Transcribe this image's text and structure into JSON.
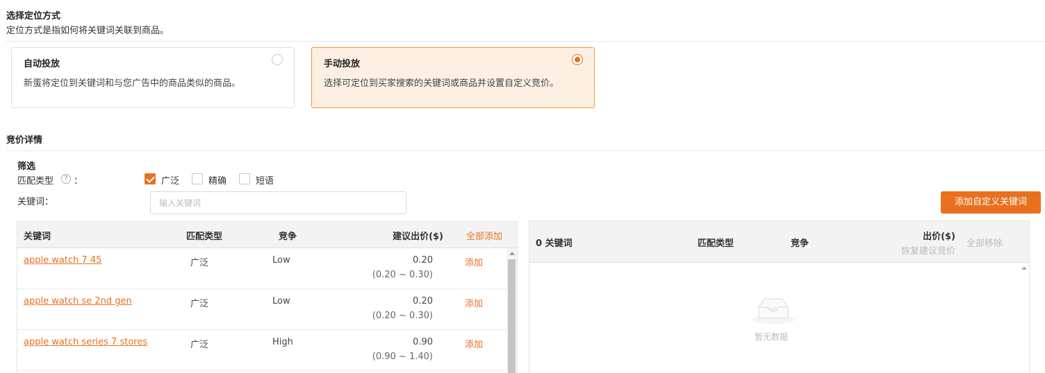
{
  "targeting": {
    "title": "选择定位方式",
    "description": "定位方式是指如何将关键词关联到商品。",
    "options": [
      {
        "title": "自动投放",
        "description": "新蛋将定位到关键词和与您广告中的商品类似的商品。",
        "selected": false
      },
      {
        "title": "手动投放",
        "description": "选择可定位到买家搜索的关键词或商品并设置自定义竞价。",
        "selected": true
      }
    ]
  },
  "bidding": {
    "title": "竞价详情",
    "filter_title": "筛选",
    "match_type_label": "匹配类型",
    "help_glyph": "?",
    "colon": "：",
    "match_options": [
      {
        "label": "广泛",
        "checked": true
      },
      {
        "label": "精确",
        "checked": false
      },
      {
        "label": "短语",
        "checked": false
      }
    ],
    "keyword_label": "关键词：",
    "keyword_placeholder": "输入关键词",
    "add_custom_button": "添加自定义关键词"
  },
  "suggested_table": {
    "headers": {
      "keyword": "关键词",
      "match_type": "匹配类型",
      "competition": "竞争",
      "suggested_bid": "建议出价($)",
      "add_all": "全部添加"
    },
    "rows": [
      {
        "keyword": "apple watch 7 45",
        "match_type": "广泛",
        "competition": "Low",
        "bid": "0.20",
        "range": "(0.20 ~ 0.30)",
        "action": "添加"
      },
      {
        "keyword": "apple watch se 2nd gen",
        "match_type": "广泛",
        "competition": "Low",
        "bid": "0.20",
        "range": "(0.20 ~ 0.30)",
        "action": "添加"
      },
      {
        "keyword": "apple watch series 7 stores",
        "match_type": "广泛",
        "competition": "High",
        "bid": "0.90",
        "range": "(0.90 ~ 1.40)",
        "action": "添加"
      }
    ]
  },
  "selected_table": {
    "headers": {
      "count": "0 关键词",
      "match_type": "匹配类型",
      "competition": "竞争",
      "bid": "出价($)",
      "restore": "恢复建议竞价",
      "remove_all": "全部移除"
    },
    "empty_text": "暂无数据"
  },
  "colors": {
    "accent": "#e8701e",
    "selected_card_bg": "#fdf0e2",
    "selected_card_border": "#f0953c"
  },
  "icons": [
    "help-icon",
    "checkbox-icon",
    "radio-icon",
    "empty-inbox-icon",
    "scroll-up-arrow-icon"
  ]
}
